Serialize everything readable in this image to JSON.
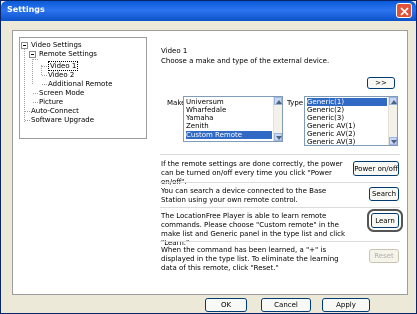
{
  "window": {
    "title": "Settings"
  },
  "tree": {
    "video_settings": "Video Settings",
    "remote_settings": "Remote Settings",
    "video1": "Video 1",
    "video2": "Video 2",
    "additional_remote": "Additional Remote",
    "screen_mode": "Screen Mode",
    "picture": "Picture",
    "auto_connect": "Auto-Connect",
    "software_upgrade": "Software Upgrade"
  },
  "main": {
    "heading": "Video 1",
    "instruction": "Choose a make and type of the external device.",
    "next_button": ">>",
    "make_label": "Make",
    "type_label": "Type",
    "make_options": [
      "Universum",
      "Wharfedale",
      "Yamaha",
      "Zenith",
      "Custom Remote"
    ],
    "make_selected": "Custom Remote",
    "type_options": [
      "Generic(1)",
      "Generic(2)",
      "Generic(3)",
      "Generic AV(1)",
      "Generic AV(2)",
      "Generic AV(3)"
    ],
    "type_selected": "Generic(1)",
    "power_text": "If the remote settings are done correctly, the power can be turned on/off every time you click \"Power on/off\".",
    "power_button": "Power on/off",
    "search_text": "You can search a device connected to the Base Station using your own remote control.",
    "search_button": "Search",
    "learn_text": "The LocationFree Player is able to learn remote commands. Please choose \"Custom remote\" in the make list and Generic panel in the type list and click \"Learn.\"",
    "learn_button": "Learn",
    "reset_text": "When the command has been learned, a \"+\" is displayed in the type list. To eliminate the learning data of this remote, click \"Reset.\"",
    "reset_button": "Reset"
  },
  "footer": {
    "ok": "OK",
    "cancel": "Cancel",
    "apply": "Apply"
  }
}
